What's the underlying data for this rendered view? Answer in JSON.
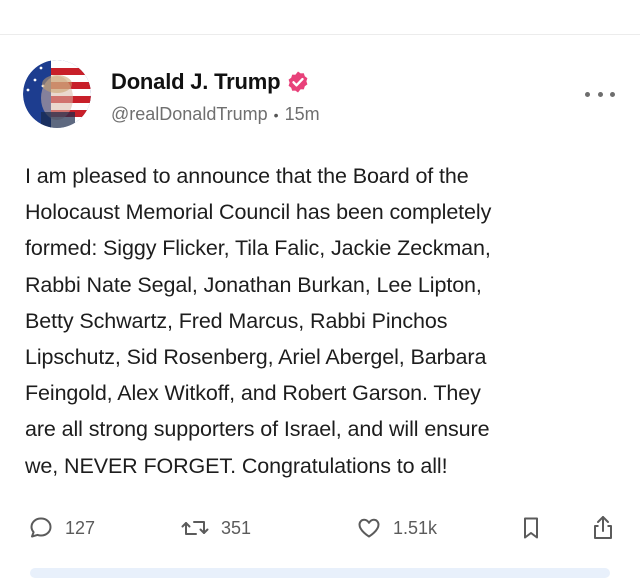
{
  "post": {
    "display_name": "Donald J. Trump",
    "handle": "@realDonaldTrump",
    "separator": "•",
    "time": "15m",
    "body_lines": [
      "I am pleased to announce that the Board of the",
      "Holocaust Memorial Council has been completely",
      "formed: Siggy Flicker, Tila Falic, Jackie Zeckman,",
      "Rabbi Nate Segal, Jonathan Burkan, Lee Lipton,",
      "Betty Schwartz, Fred Marcus, Rabbi Pinchos",
      "Lipschutz, Sid Rosenberg, Ariel Abergel, Barbara",
      "Feingold, Alex Witkoff, and Robert Garson. They",
      "are all strong supporters of Israel, and will ensure",
      "we, NEVER FORGET. Congratulations to all!"
    ]
  },
  "actions": {
    "replies": "127",
    "reposts": "351",
    "likes": "1.51k"
  },
  "icons": {
    "verified": "verified-badge-icon",
    "more": "more-options-icon",
    "reply": "reply-icon",
    "repost": "repost-icon",
    "like": "heart-icon",
    "bookmark": "bookmark-icon",
    "share": "share-icon"
  },
  "colors": {
    "verified_badge": "#e8417a",
    "icon_gray": "#5b5b5b"
  }
}
